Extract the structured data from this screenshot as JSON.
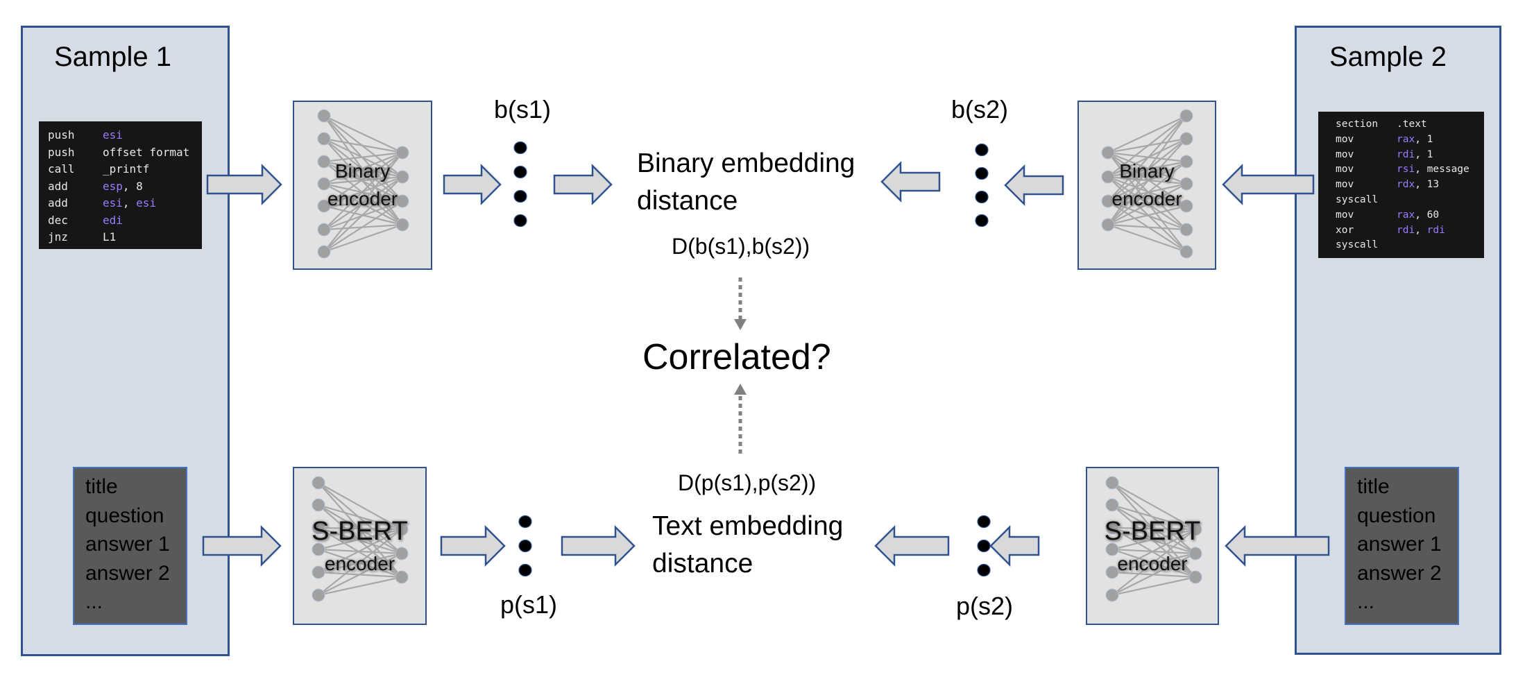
{
  "sample1": {
    "title": "Sample 1",
    "code": [
      {
        "op": "push",
        "args": [
          {
            "t": "esi",
            "reg": true
          }
        ]
      },
      {
        "op": "push",
        "args": [
          {
            "t": "offset format",
            "reg": false
          }
        ]
      },
      {
        "op": "call",
        "args": [
          {
            "t": "_printf",
            "reg": false
          }
        ]
      },
      {
        "op": "add",
        "args": [
          {
            "t": "esp",
            "reg": true
          },
          {
            "t": ", 8",
            "reg": false
          }
        ]
      },
      {
        "op": "add",
        "args": [
          {
            "t": "esi",
            "reg": true
          },
          {
            "t": ", ",
            "reg": false
          },
          {
            "t": "esi",
            "reg": true
          }
        ]
      },
      {
        "op": "dec",
        "args": [
          {
            "t": "edi",
            "reg": true
          }
        ]
      },
      {
        "op": "jnz",
        "args": [
          {
            "t": "L1",
            "reg": false
          }
        ]
      }
    ],
    "text_fields": [
      "title",
      "question",
      "answer 1",
      "answer 2",
      "..."
    ]
  },
  "sample2": {
    "title": "Sample 2",
    "code": [
      {
        "op": "section",
        "args": [
          {
            "t": ".text",
            "reg": false
          }
        ]
      },
      {
        "op": "mov",
        "args": [
          {
            "t": "rax",
            "reg": true
          },
          {
            "t": ", 1",
            "reg": false
          }
        ]
      },
      {
        "op": "mov",
        "args": [
          {
            "t": "rdi",
            "reg": true
          },
          {
            "t": ", 1",
            "reg": false
          }
        ]
      },
      {
        "op": "mov",
        "args": [
          {
            "t": "rsi",
            "reg": true
          },
          {
            "t": ", message",
            "reg": false
          }
        ]
      },
      {
        "op": "mov",
        "args": [
          {
            "t": "rdx",
            "reg": true
          },
          {
            "t": ", 13",
            "reg": false
          }
        ]
      },
      {
        "op": "syscall",
        "args": []
      },
      {
        "op": "mov",
        "args": [
          {
            "t": "rax",
            "reg": true
          },
          {
            "t": ", 60",
            "reg": false
          }
        ]
      },
      {
        "op": "xor",
        "args": [
          {
            "t": "rdi",
            "reg": true
          },
          {
            "t": ", ",
            "reg": false
          },
          {
            "t": "rdi",
            "reg": true
          }
        ]
      },
      {
        "op": "syscall",
        "args": []
      }
    ],
    "text_fields": [
      "title",
      "question",
      "answer 1",
      "answer 2",
      "..."
    ]
  },
  "encoders": {
    "binary_line1": "Binary",
    "binary_line2": "encoder",
    "sbert_line1": "S-BERT",
    "sbert_line2": "encoder"
  },
  "embeddings": {
    "b_s1": "b(s1)",
    "b_s2": "b(s2)",
    "p_s1": "p(s1)",
    "p_s2": "p(s2)",
    "binary_vector_length_shown": 4,
    "text_vector_length_shown": 3
  },
  "center": {
    "binary_distance_line1": "Binary embedding",
    "binary_distance_line2": "distance",
    "binary_distance_formula": "D(b(s1),b(s2))",
    "question": "Correlated?",
    "text_distance_formula": "D(p(s1),p(s2))",
    "text_distance_line1": "Text embedding",
    "text_distance_line2": "distance"
  },
  "colors": {
    "panel_fill": "#d6dce5",
    "border_blue": "#2f528f",
    "arrow_fill": "#d9d9d9",
    "register_purple": "#9b7bff",
    "code_bg": "#161616",
    "textbox_bg": "#595959",
    "encoder_fill": "#e2e2e2",
    "node_gray": "#a0a0a0",
    "dashed_gray": "#808080"
  }
}
